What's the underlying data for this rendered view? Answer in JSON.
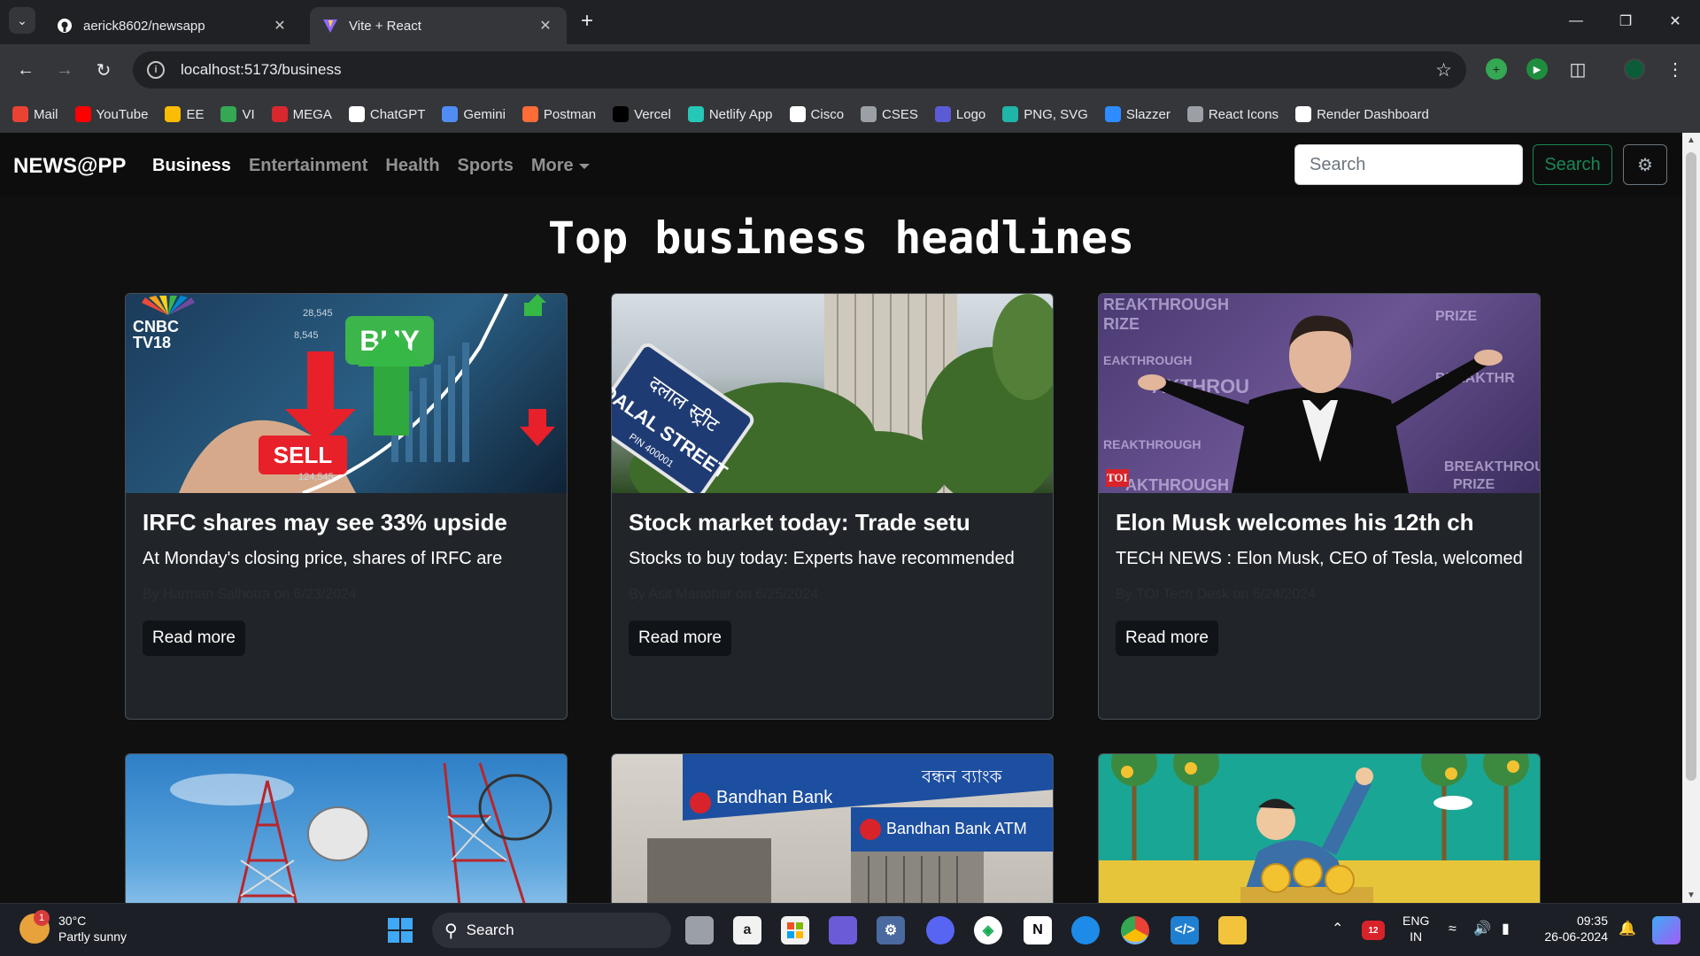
{
  "browser": {
    "tabs": [
      {
        "title": "aerick8602/newsapp",
        "icon": "github-icon"
      },
      {
        "title": "Vite + React",
        "icon": "vite-icon"
      }
    ],
    "url": "localhost:5173/business",
    "bookmarks": [
      {
        "label": "Mail",
        "color": "#ea4335"
      },
      {
        "label": "YouTube",
        "color": "#ff0000"
      },
      {
        "label": "EE",
        "color": "#fbbc04"
      },
      {
        "label": "VI",
        "color": "#34a853"
      },
      {
        "label": "MEGA",
        "color": "#d9272e"
      },
      {
        "label": "ChatGPT",
        "color": "#ffffff"
      },
      {
        "label": "Gemini",
        "color": "#4f8df5"
      },
      {
        "label": "Postman",
        "color": "#ff6c37"
      },
      {
        "label": "Vercel",
        "color": "#000000"
      },
      {
        "label": "Netlify App",
        "color": "#25c7b7"
      },
      {
        "label": "Cisco",
        "color": "#ffffff"
      },
      {
        "label": "CSES",
        "color": "#9aa0a6"
      },
      {
        "label": "Logo",
        "color": "#5b5bd6"
      },
      {
        "label": "PNG, SVG",
        "color": "#1fb5a8"
      },
      {
        "label": "Slazzer",
        "color": "#2d8cff"
      },
      {
        "label": "React Icons",
        "color": "#9aa0a6"
      },
      {
        "label": "Render Dashboard",
        "color": "#ffffff"
      }
    ]
  },
  "app": {
    "brand": "NEWS@PP",
    "nav": [
      {
        "label": "Business",
        "active": true
      },
      {
        "label": "Entertainment",
        "active": false
      },
      {
        "label": "Health",
        "active": false
      },
      {
        "label": "Sports",
        "active": false
      },
      {
        "label": "More",
        "active": false
      }
    ],
    "search_placeholder": "Search",
    "search_button": "Search",
    "heading": "Top business headlines",
    "read_more": "Read more",
    "cards": [
      {
        "title": "IRFC shares may see 33% upside",
        "description": "At Monday's closing price, shares of IRFC are",
        "meta": "By Harman Salhotra on 6/23/2024",
        "image": "stock-buy-sell-image",
        "image_caption": "CNBC TV18"
      },
      {
        "title": "Stock market today: Trade setu",
        "description": "Stocks to buy today: Experts have recommended",
        "meta": "By Asit Manohar on 6/25/2024",
        "image": "dalal-street-image",
        "image_caption": "DALAL STREET"
      },
      {
        "title": "Elon Musk welcomes his 12th ch",
        "description": "TECH NEWS : Elon Musk, CEO of Tesla, welcomed",
        "meta": "By TOI Tech Desk on 6/24/2024",
        "image": "elon-musk-image",
        "image_caption": "TOI"
      },
      {
        "title": "",
        "description": "",
        "meta": "",
        "image": "telecom-tower-image",
        "image_caption": ""
      },
      {
        "title": "",
        "description": "",
        "meta": "",
        "image": "bandhan-bank-image",
        "image_caption": "Bandhan Bank ATM"
      },
      {
        "title": "",
        "description": "",
        "meta": "",
        "image": "money-tree-image",
        "image_caption": ""
      }
    ]
  },
  "taskbar": {
    "temperature": "30°C",
    "weather": "Partly sunny",
    "weather_badge": "1",
    "search": "Search",
    "language": "ENG",
    "region": "IN",
    "time": "09:35",
    "date": "26-06-2024",
    "calendar_badge": "12"
  }
}
